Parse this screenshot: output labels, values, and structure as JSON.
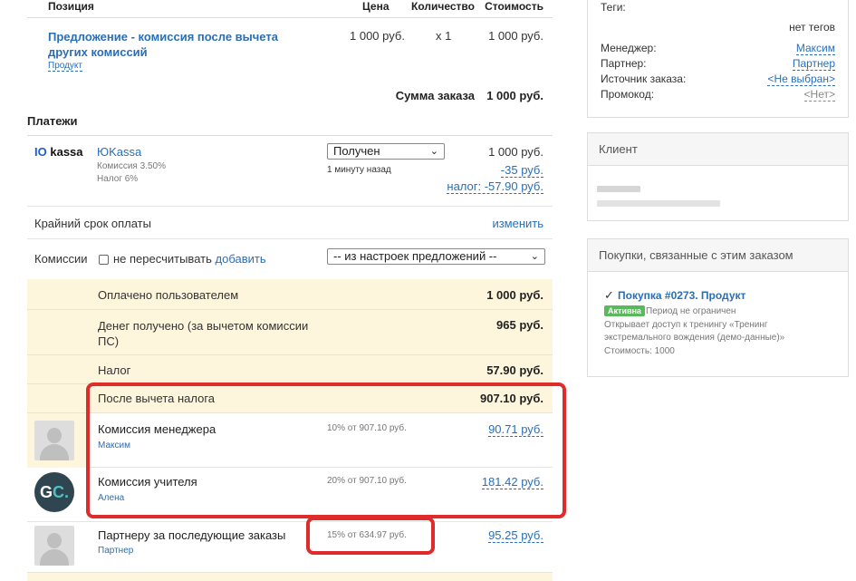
{
  "order_table": {
    "headers": {
      "position": "Позиция",
      "price": "Цена",
      "quantity": "Количество",
      "cost": "Стоимость"
    },
    "item": {
      "title": "Предложение - комиссия после вычета других комиссий",
      "type": "Продукт",
      "price": "1 000 руб.",
      "quantity": "x 1",
      "cost": "1 000 руб."
    },
    "total_label": "Сумма заказа",
    "total_value": "1 000 руб."
  },
  "payments": {
    "heading": "Платежи",
    "provider_logo": "kassa",
    "provider_name": "ЮKassa",
    "fee": "Комиссия 3.50%",
    "tax": "Налог 6%",
    "status": "Получен",
    "status_time": "1 минуту назад",
    "amount": "1 000 руб.",
    "fee_amount": "-35 руб.",
    "tax_amount": "налог: -57.90 руб."
  },
  "deadline": {
    "label": "Крайний срок оплаты",
    "action": "изменить"
  },
  "commissions": {
    "label": "Комиссии",
    "checkbox_label": "не пересчитывать",
    "add_link": "добавить",
    "source_select": "-- из настроек предложений --"
  },
  "summary": [
    {
      "label": "Оплачено пользователем",
      "value": "1 000 руб."
    },
    {
      "label": "Денег получено (за вычетом комиссии ПС)",
      "value": "965 руб."
    },
    {
      "label": "Налог",
      "value": "57.90 руб."
    },
    {
      "label": "После вычета налога",
      "value": "907.10 руб."
    }
  ],
  "commission_rows": [
    {
      "name": "Комиссия менеджера",
      "person": "Максим",
      "formula": "10% от 907.10 руб.",
      "value": "90.71 руб.",
      "avatar": "person"
    },
    {
      "name": "Комиссия учителя",
      "person": "Алена",
      "formula": "20% от 907.10 руб.",
      "value": "181.42 руб.",
      "avatar": "gc"
    },
    {
      "name": "Партнеру за последующие заказы",
      "person": "Партнер",
      "formula": "15% от 634.97 руб.",
      "value": "95.25 руб.",
      "avatar": "person"
    }
  ],
  "gc_avatar": {
    "g": "G",
    "c": "C."
  },
  "details_card": {
    "tags_label": "Теги:",
    "tags_value": "нет тегов",
    "manager_label": "Менеджер:",
    "manager_value": "Максим",
    "partner_label": "Партнер:",
    "partner_value": "Партнер",
    "source_label": "Источник заказа:",
    "source_value": "<Не выбран>",
    "promo_label": "Промокод:",
    "promo_value": "<Нет>"
  },
  "client_card": {
    "title": "Клиент"
  },
  "purchases_card": {
    "title": "Покупки, связанные с этим заказом",
    "purchase_title": "Покупка #0273. Продукт",
    "status_badge": "Активна",
    "period": "Период не ограничен",
    "description": "Открывает доступ к тренингу «Тренинг экстремального вождения (демо-данные)»",
    "cost": "Стоимость: 1000"
  },
  "colors": {
    "accent": "#2a6fb5",
    "highlight": "#e02b2b",
    "summary_bg": "#fdf6dc",
    "active_badge": "#5cb85c"
  }
}
